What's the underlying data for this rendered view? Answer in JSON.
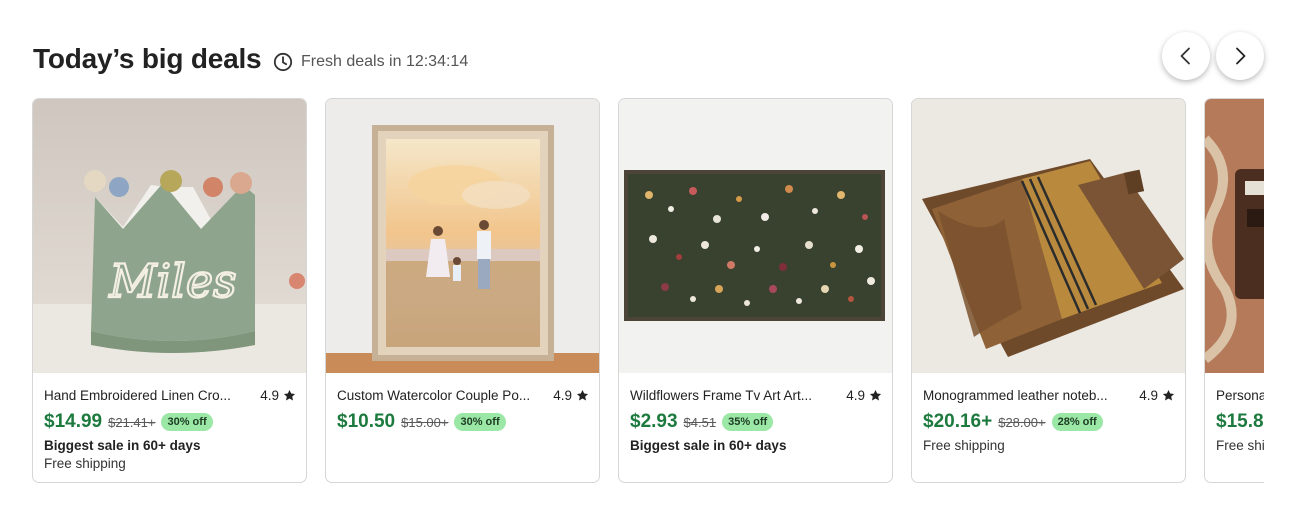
{
  "header": {
    "title": "Today’s big deals",
    "timer_text": "Fresh deals in 12:34:14",
    "timer_icon": "clock-icon"
  },
  "nav": {
    "prev_icon": "chevron-left-icon",
    "next_icon": "chevron-right-icon"
  },
  "colors": {
    "price": "#1d7a3f",
    "badge_bg": "#9be7a6"
  },
  "products": [
    {
      "name": "Hand Embroidered Linen Cro...",
      "rating": "4.9",
      "price": "$14.99",
      "original_price": "$21.41+",
      "discount": "30% off",
      "note": "Biggest sale in 60+ days",
      "shipping": "Free shipping",
      "image_text": "Miles"
    },
    {
      "name": "Custom Watercolor Couple Po...",
      "rating": "4.9",
      "price": "$10.50",
      "original_price": "$15.00+",
      "discount": "30% off",
      "note": "",
      "shipping": ""
    },
    {
      "name": "Wildflowers Frame Tv Art Art...",
      "rating": "4.9",
      "price": "$2.93",
      "original_price": "$4.51",
      "discount": "35% off",
      "note": "Biggest sale in 60+ days",
      "shipping": ""
    },
    {
      "name": "Monogrammed leather noteb...",
      "rating": "4.9",
      "price": "$20.16+",
      "original_price": "$28.00+",
      "discount": "28% off",
      "note": "",
      "shipping": "Free shipping"
    },
    {
      "name": "Persona",
      "price": "$15.8",
      "shipping": "Free shi"
    }
  ]
}
